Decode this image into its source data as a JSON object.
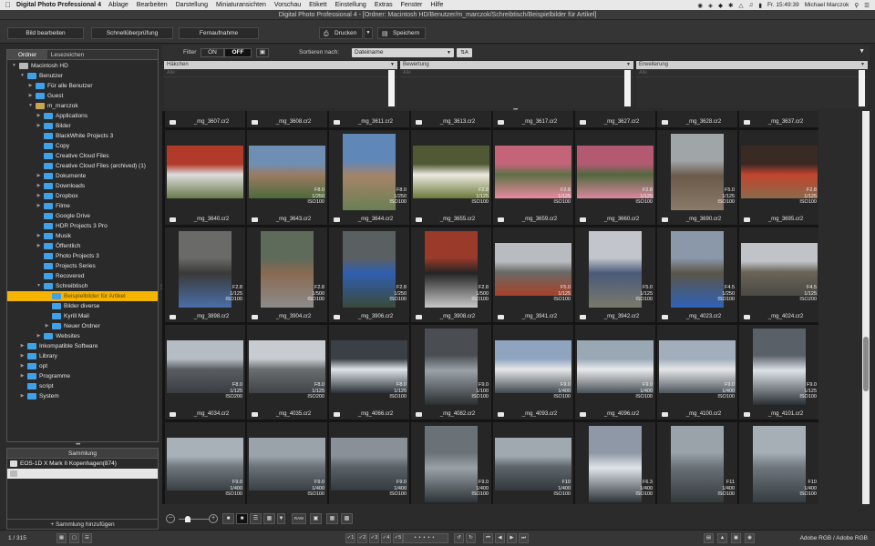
{
  "menubar": {
    "app_name": "Digital Photo Professional 4",
    "menus": [
      "Ablage",
      "Bearbeiten",
      "Darstellung",
      "Miniaturansichten",
      "Vorschau",
      "Etikett",
      "Einstellung",
      "Extras",
      "Fenster",
      "Hilfe"
    ],
    "clock": "Fr. 15:49:39",
    "user": "Michael Marczok"
  },
  "window": {
    "title": "Digital Photo Professional 4 - [Ordner: Macintosh HD/Benutzer/m_marczok/Schreibtisch/Beispielbilder für Artikel]"
  },
  "toolbar": {
    "tabs": [
      "Bild bearbeiten",
      "Schnellüberprüfung",
      "Fernaufnahme"
    ],
    "print_label": "Drucken",
    "save_label": "Speichern"
  },
  "left_panel": {
    "tabs": [
      "Ordner",
      "Lesezeichen"
    ],
    "tree": [
      {
        "label": "Macintosh HD",
        "level": 0,
        "expanded": true,
        "kind": "drive"
      },
      {
        "label": "Benutzer",
        "level": 1,
        "expanded": true
      },
      {
        "label": "Für alle Benutzer",
        "level": 2,
        "expanded": false
      },
      {
        "label": "Guest",
        "level": 2,
        "expanded": false
      },
      {
        "label": "m_marczok",
        "level": 2,
        "expanded": true,
        "kind": "home"
      },
      {
        "label": "Applications",
        "level": 3,
        "expanded": false
      },
      {
        "label": "Bilder",
        "level": 3,
        "expanded": false
      },
      {
        "label": "BlackWhite Projects 3",
        "level": 3,
        "expanded": false,
        "leaf": true
      },
      {
        "label": "Copy",
        "level": 3,
        "leaf": true
      },
      {
        "label": "Creative Cloud Files",
        "level": 3,
        "leaf": true
      },
      {
        "label": "Creative Cloud Files (archived) (1)",
        "level": 3,
        "leaf": true
      },
      {
        "label": "Dokumente",
        "level": 3,
        "expanded": false
      },
      {
        "label": "Downloads",
        "level": 3,
        "expanded": false
      },
      {
        "label": "Dropbox",
        "level": 3,
        "expanded": false
      },
      {
        "label": "Filme",
        "level": 3,
        "expanded": false
      },
      {
        "label": "Google Drive",
        "level": 3,
        "leaf": true
      },
      {
        "label": "HDR Projects 3 Pro",
        "level": 3,
        "leaf": true
      },
      {
        "label": "Musik",
        "level": 3,
        "expanded": false
      },
      {
        "label": "Öffentlich",
        "level": 3,
        "expanded": false
      },
      {
        "label": "Photo Projects 3",
        "level": 3,
        "leaf": true
      },
      {
        "label": "Projects Series",
        "level": 3,
        "leaf": true
      },
      {
        "label": "Recovered",
        "level": 3,
        "leaf": true
      },
      {
        "label": "Schreibtisch",
        "level": 3,
        "expanded": true
      },
      {
        "label": "Beispielbilder für Artikel",
        "level": 4,
        "leaf": true,
        "selected": true
      },
      {
        "label": "Bilder diverse",
        "level": 4,
        "leaf": true
      },
      {
        "label": "Kyrill Mail",
        "level": 4,
        "leaf": true
      },
      {
        "label": "Neuer Ordner",
        "level": 4,
        "expanded": false
      },
      {
        "label": "Websites",
        "level": 3,
        "expanded": false
      },
      {
        "label": "Inkompatible Software",
        "level": 1,
        "expanded": false
      },
      {
        "label": "Library",
        "level": 1,
        "expanded": false
      },
      {
        "label": "opt",
        "level": 1,
        "expanded": false
      },
      {
        "label": "Programme",
        "level": 1,
        "expanded": false
      },
      {
        "label": "script",
        "level": 1,
        "leaf": true
      },
      {
        "label": "System",
        "level": 1,
        "expanded": false
      }
    ]
  },
  "collection": {
    "title": "Sammlung",
    "items": [
      "EOS-1D X Mark II Kopenhagen(874)",
      ""
    ],
    "add_label": "+ Sammlung hinzufügen"
  },
  "filterbar": {
    "filter_label": "Filter",
    "on_label": "ON",
    "off_label": "OFF",
    "sort_label": "Sortieren nach:",
    "sort_value": "Dateiname",
    "columns": [
      {
        "header": "Häkchen",
        "sub": "Alle"
      },
      {
        "header": "Bewertung",
        "sub": "Alle"
      },
      {
        "header": "Erweiterung",
        "sub": "Alle"
      }
    ]
  },
  "grid": {
    "top_row": [
      "_mg_3607.cr2",
      "_mg_3608.cr2",
      "_mg_3611.cr2",
      "_mg_3613.cr2",
      "_mg_3617.cr2",
      "_mg_3627.cr2",
      "_mg_3628.cr2",
      "_mg_3637.cr2"
    ],
    "rows": [
      [
        {
          "name": "_mg_3640.cr2",
          "exif": [
            "",
            "",
            ""
          ],
          "colors": [
            "#b23a2a",
            "#ddd",
            "#6a7a4a"
          ]
        },
        {
          "name": "_mg_3643.cr2",
          "exif": [
            "F8.0",
            "1/250",
            "ISO100"
          ],
          "colors": [
            "#6e8fb3",
            "#9c7b63",
            "#4d6a3a"
          ]
        },
        {
          "name": "_mg_3644.cr2",
          "exif": [
            "F8.0",
            "1/250",
            "ISO100"
          ],
          "colors": [
            "#5f87b8",
            "#a58468",
            "#6a7f54"
          ]
        },
        {
          "name": "_mg_3655.cr2",
          "exif": [
            "F2.8",
            "1/125",
            "ISO100"
          ],
          "colors": [
            "#4f5a34",
            "#eeeae0",
            "#6a7a3a"
          ]
        },
        {
          "name": "_mg_3659.cr2",
          "exif": [
            "F2.8",
            "1/125",
            "ISO100"
          ],
          "colors": [
            "#c46479",
            "#5e7046",
            "#e98aa0"
          ]
        },
        {
          "name": "_mg_3660.cr2",
          "exif": [
            "F2.8",
            "1/125",
            "ISO100"
          ],
          "colors": [
            "#b35a72",
            "#53683f",
            "#d8889c"
          ]
        },
        {
          "name": "_mg_3690.cr2",
          "exif": [
            "F5.0",
            "1/125",
            "ISO100"
          ],
          "colors": [
            "#a0a6a8",
            "#6b5a4a",
            "#8a7a6a"
          ]
        },
        {
          "name": "_mg_3695.cr2",
          "exif": [
            "F2.8",
            "1/125",
            "ISO100"
          ],
          "colors": [
            "#3a2a24",
            "#c2452e",
            "#8a6a4a"
          ]
        }
      ],
      [
        {
          "name": "_mg_3898.cr2",
          "exif": [
            "F2.8",
            "1/125",
            "ISO100"
          ],
          "colors": [
            "#6a6a68",
            "#3a3a38",
            "#4a6fa8"
          ]
        },
        {
          "name": "_mg_3904.cr2",
          "exif": [
            "F2.8",
            "1/500",
            "ISO100"
          ],
          "colors": [
            "#5e6a5a",
            "#8a6a52",
            "#8c8c8a"
          ]
        },
        {
          "name": "_mg_3906.cr2",
          "exif": [
            "F2.8",
            "1/250",
            "ISO100"
          ],
          "colors": [
            "#5a5f62",
            "#2f5fb0",
            "#3a4a3a"
          ]
        },
        {
          "name": "_mg_3908.cr2",
          "exif": [
            "F2.8",
            "1/500",
            "ISO100"
          ],
          "colors": [
            "#9a3a2a",
            "#242424",
            "#c8c8c8"
          ]
        },
        {
          "name": "_mg_3941.cr2",
          "exif": [
            "F5.0",
            "1/125",
            "ISO100"
          ],
          "colors": [
            "#b8bcc0",
            "#6a6a66",
            "#a8412a"
          ]
        },
        {
          "name": "_mg_3942.cr2",
          "exif": [
            "F5.0",
            "1/125",
            "ISO100"
          ],
          "colors": [
            "#c2c6cc",
            "#4a5a7a",
            "#7a7a6a"
          ]
        },
        {
          "name": "_mg_4023.cr2",
          "exif": [
            "F4.5",
            "1/250",
            "ISO100"
          ],
          "colors": [
            "#8a98aa",
            "#5a5548",
            "#2f62b8"
          ]
        },
        {
          "name": "_mg_4024.cr2",
          "exif": [
            "F4.5",
            "1/125",
            "ISO200"
          ],
          "colors": [
            "#c0c4c8",
            "#6a6458",
            "#4a4a44"
          ]
        }
      ],
      [
        {
          "name": "_mg_4034.cr2",
          "exif": [
            "F8.0",
            "1/125",
            "ISO200"
          ],
          "colors": [
            "#b6bcc4",
            "#5a5e62",
            "#3a3e42"
          ]
        },
        {
          "name": "_mg_4035.cr2",
          "exif": [
            "F8.0",
            "1/125",
            "ISO200"
          ],
          "colors": [
            "#c8ccd0",
            "#6a6e70",
            "#404448"
          ]
        },
        {
          "name": "_mg_4066.cr2",
          "exif": [
            "F8.0",
            "1/125",
            "ISO100"
          ],
          "colors": [
            "#3a4046",
            "#dfe4ea",
            "#2a3036"
          ]
        },
        {
          "name": "_mg_4082.cr2",
          "exif": [
            "F9.0",
            "1/100",
            "ISO100"
          ],
          "colors": [
            "#4a4e52",
            "#9aa2a8",
            "#2a2e30"
          ]
        },
        {
          "name": "_mg_4093.cr2",
          "exif": [
            "F9.0",
            "1/400",
            "ISO100"
          ],
          "colors": [
            "#8fa4bf",
            "#e6e8ea",
            "#40484e"
          ]
        },
        {
          "name": "_mg_4096.cr2",
          "exif": [
            "F9.0",
            "1/400",
            "ISO100"
          ],
          "colors": [
            "#9aa8b6",
            "#e8eaec",
            "#4a5258"
          ]
        },
        {
          "name": "_mg_4100.cr2",
          "exif": [
            "F9.0",
            "1/400",
            "ISO100"
          ],
          "colors": [
            "#a2aebb",
            "#e4e6e8",
            "#4e565c"
          ]
        },
        {
          "name": "_mg_4101.cr2",
          "exif": [
            "F9.0",
            "1/125",
            "ISO100"
          ],
          "colors": [
            "#5a6068",
            "#dde2e8",
            "#2a3034"
          ]
        }
      ],
      [
        {
          "name": "",
          "exif": [
            "F9.0",
            "1/400",
            "ISO100"
          ],
          "colors": [
            "#a8b0b8",
            "#70787e",
            "#3a4044"
          ]
        },
        {
          "name": "",
          "exif": [
            "F9.0",
            "1/400",
            "ISO100"
          ],
          "colors": [
            "#9aa2aa",
            "#6a7278",
            "#3a4044"
          ]
        },
        {
          "name": "",
          "exif": [
            "F9.0",
            "1/400",
            "ISO100"
          ],
          "colors": [
            "#8a9098",
            "#5a6268",
            "#343a3e"
          ]
        },
        {
          "name": "",
          "exif": [
            "F9.0",
            "1/400",
            "ISO100"
          ],
          "colors": [
            "#6a7278",
            "#9aa2a8",
            "#2e3438"
          ]
        },
        {
          "name": "",
          "exif": [
            "F10",
            "1/400",
            "ISO100"
          ],
          "colors": [
            "#a0a8b0",
            "#5e666c",
            "#32383c"
          ]
        },
        {
          "name": "",
          "exif": [
            "F6.3",
            "1/400",
            "ISO100"
          ],
          "colors": [
            "#8e98a6",
            "#dfe4ea",
            "#30363a"
          ]
        },
        {
          "name": "",
          "exif": [
            "F11",
            "1/400",
            "ISO100"
          ],
          "colors": [
            "#9aa2aa",
            "#687076",
            "#34393c"
          ]
        },
        {
          "name": "",
          "exif": [
            "F10",
            "1/400",
            "ISO100"
          ],
          "colors": [
            "#a6aeb6",
            "#6e767c",
            "#363c40"
          ]
        }
      ]
    ]
  },
  "statusbar": {
    "count": "1 / 315",
    "color_space": "Adobe RGB / Adobe RGB",
    "raw_label": "RAW"
  }
}
